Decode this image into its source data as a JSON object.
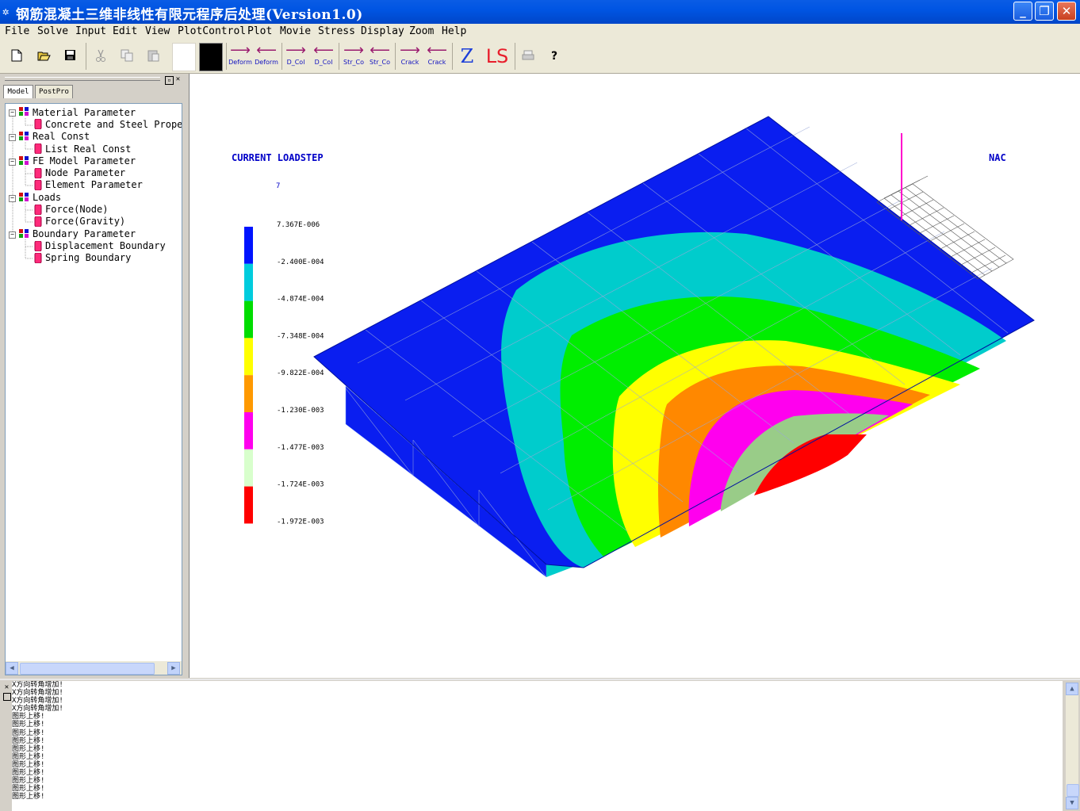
{
  "window": {
    "title": "钢筋混凝土三维非线性有限元程序后处理(Version1.0)",
    "icon": "app-icon"
  },
  "menu": [
    "File",
    "Solve",
    "Input",
    "Edit",
    "View",
    "PlotControl",
    "Plot",
    "Movie",
    "Stress",
    "Display",
    "Zoom",
    "Help"
  ],
  "toolbar": {
    "buttons": [
      {
        "name": "Deform",
        "icon": "arrow-right-icon"
      },
      {
        "name": "Deform",
        "icon": "arrow-left-icon"
      },
      {
        "name": "D_Col",
        "icon": "arrow-right-icon"
      },
      {
        "name": "D_Col",
        "icon": "arrow-left-icon"
      },
      {
        "name": "Str_Co",
        "icon": "arrow-right-icon"
      },
      {
        "name": "Str_Co",
        "icon": "arrow-left-icon"
      },
      {
        "name": "Crack",
        "icon": "arrow-right-icon"
      },
      {
        "name": "Crack",
        "icon": "arrow-left-icon"
      }
    ],
    "z_label": "Z",
    "ls_label": "LS",
    "help_label": "?"
  },
  "tabs": [
    "Model",
    "PostPro"
  ],
  "tree": [
    {
      "label": "Material Parameter",
      "level": 0
    },
    {
      "label": "Concrete and Steel Proper",
      "level": 1
    },
    {
      "label": "Real Const",
      "level": 0
    },
    {
      "label": "List Real Const",
      "level": 1
    },
    {
      "label": "FE Model Parameter",
      "level": 0
    },
    {
      "label": "Node Parameter",
      "level": 1
    },
    {
      "label": "Element Parameter",
      "level": 1
    },
    {
      "label": "Loads",
      "level": 0
    },
    {
      "label": "Force(Node)",
      "level": 1
    },
    {
      "label": "Force(Gravity)",
      "level": 1
    },
    {
      "label": "Boundary Parameter",
      "level": 0
    },
    {
      "label": "Displacement Boundary",
      "level": 1
    },
    {
      "label": "Spring Boundary",
      "level": 1
    }
  ],
  "plot": {
    "current_loadstep_label": "CURRENT LOADSTEP",
    "loadstep_value": "7",
    "corner_label": "NAC",
    "legend": {
      "values": [
        "7.367E-006",
        "-2.400E-004",
        "-4.874E-004",
        "-7.348E-004",
        "-9.822E-004",
        "-1.230E-003",
        "-1.477E-003",
        "-1.724E-003",
        "-1.972E-003"
      ],
      "colors": [
        "#0014ff",
        "#00ccdd",
        "#00dd00",
        "#ffff00",
        "#ff9900",
        "#ff00ee",
        "#d8ffcc",
        "#ff0000"
      ]
    },
    "contour_colors": {
      "blue": "#0a1ef0",
      "cyan": "#00cccc",
      "green": "#00ee00",
      "yellow": "#ffff00",
      "orange": "#ff8800",
      "magenta": "#ff00ee",
      "palegreen": "#99cc88",
      "red": "#ff0000"
    }
  },
  "output": {
    "lines": [
      "X方向转角增加!",
      "X方向转角增加!",
      "X方向转角增加!",
      "X方向转角增加!",
      "图形上移!",
      "图形上移!",
      "图形上移!",
      "图形上移!",
      "图形上移!",
      "图形上移!",
      "图形上移!",
      "图形上移!",
      "图形上移!",
      "图形上移!",
      "图形上移!"
    ]
  }
}
